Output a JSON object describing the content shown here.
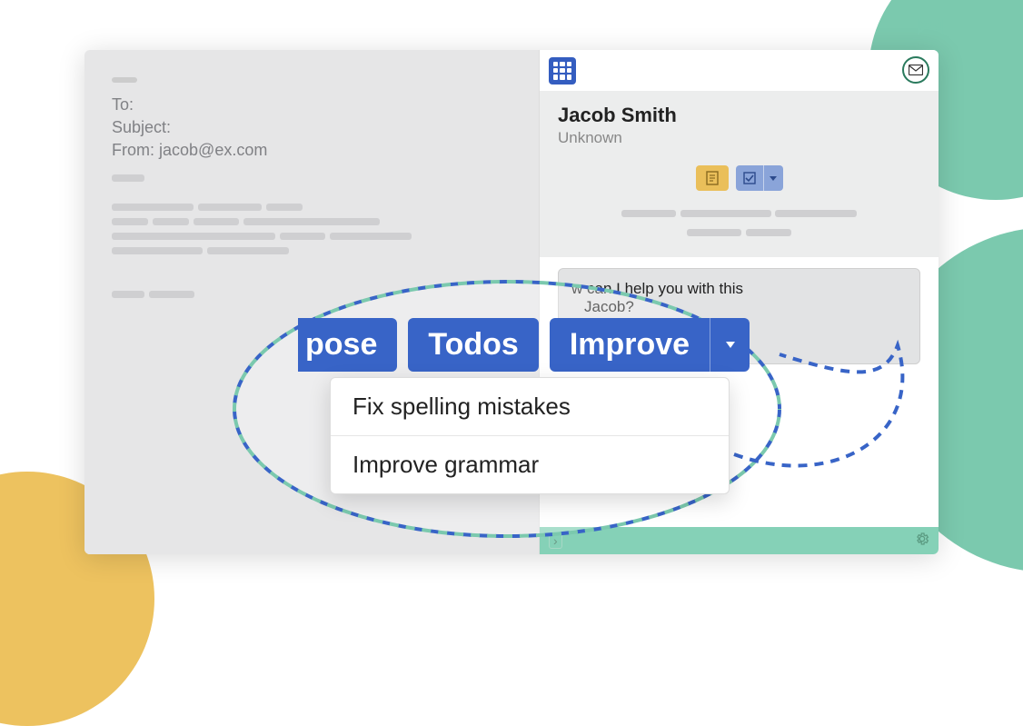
{
  "compose": {
    "to_label": "To:",
    "subject_label": "Subject:",
    "from_label": "From:",
    "from_value": "jacob@ex.com"
  },
  "sidebar": {
    "contact_name": "Jacob Smith",
    "contact_subtitle": "Unknown"
  },
  "assistant": {
    "prompt_part1": "w can I help you with this",
    "prompt_part2": "Jacob?",
    "chips": {
      "todos": "Todos",
      "improve": "Improve"
    }
  },
  "big_chips": {
    "compose_partial": "pose",
    "todos": "Todos",
    "improve": "Improve"
  },
  "dropdown": {
    "item1": "Fix spelling mistakes",
    "item2": "Improve grammar"
  }
}
